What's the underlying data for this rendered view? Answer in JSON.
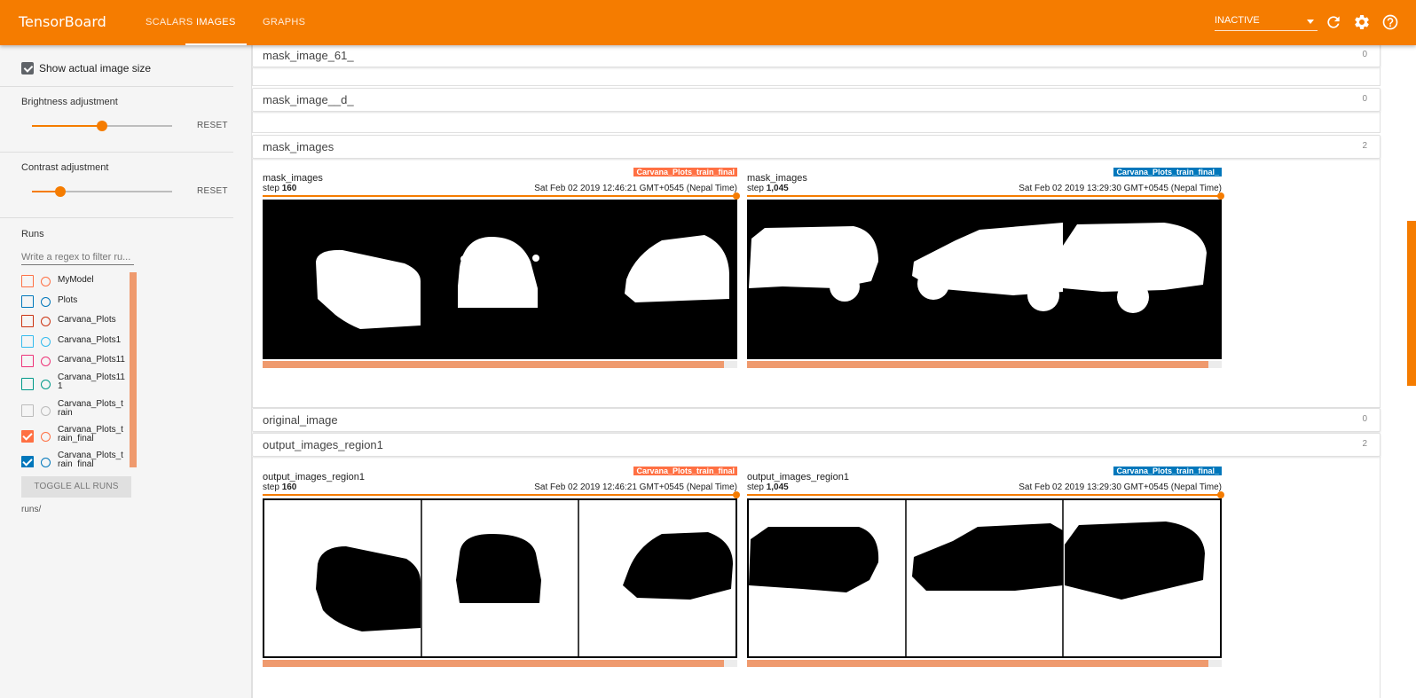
{
  "app": {
    "title": "TensorBoard"
  },
  "nav": {
    "tabs": [
      {
        "label": "SCALARS"
      },
      {
        "label": "IMAGES"
      },
      {
        "label": "GRAPHS"
      }
    ]
  },
  "header": {
    "run_select_value": "INACTIVE"
  },
  "sidebar": {
    "show_actual_size_label": "Show actual image size",
    "brightness_label": "Brightness adjustment",
    "contrast_label": "Contrast adjustment",
    "reset_label": "RESET",
    "brightness_level": 0.5,
    "contrast_level": 0.2,
    "runs_title": "Runs",
    "runs_filter_placeholder": "Write a regex to filter ru...",
    "runs": [
      {
        "name": "MyModel",
        "color": "#ff7043",
        "checked": false
      },
      {
        "name": "Plots",
        "color": "#0077bb",
        "checked": false
      },
      {
        "name": "Carvana_Plots",
        "color": "#cc3311",
        "checked": false
      },
      {
        "name": "Carvana_Plots1",
        "color": "#33bbee",
        "checked": false
      },
      {
        "name": "Carvana_Plots11",
        "color": "#ee3377",
        "checked": false
      },
      {
        "name": "Carvana_Plots111",
        "color": "#009988",
        "checked": false
      },
      {
        "name": "Carvana_Plots_train",
        "color": "#bbbbbb",
        "checked": false
      },
      {
        "name": "Carvana_Plots_train_final",
        "color": "#ff7043",
        "checked": true
      },
      {
        "name": "Carvana_Plots_train_final_",
        "color": "#0077bb",
        "checked": true
      }
    ],
    "toggle_all_label": "TOGGLE ALL RUNS",
    "logdir": "runs/"
  },
  "panes": [
    {
      "name": "mask_image_61_",
      "count": "0"
    },
    {
      "name": "mask_image__d_",
      "count": "0"
    },
    {
      "name": "mask_images",
      "count": "2"
    },
    {
      "name": "original_image",
      "count": "0"
    },
    {
      "name": "output_images_region1",
      "count": "2"
    }
  ],
  "cards": {
    "mask_left": {
      "tag": "Carvana_Plots_train_final",
      "title": "mask_images",
      "step_prefix": "step ",
      "step": "160",
      "time": "Sat Feb 02 2019 12:46:21 GMT+0545 (Nepal Time)"
    },
    "mask_right": {
      "tag": "Carvana_Plots_train_final_",
      "title": "mask_images",
      "step_prefix": "step ",
      "step": "1,045",
      "time": "Sat Feb 02 2019 13:29:30 GMT+0545 (Nepal Time)"
    },
    "out_left": {
      "tag": "Carvana_Plots_train_final",
      "title": "output_images_region1",
      "step_prefix": "step ",
      "step": "160",
      "time": "Sat Feb 02 2019 12:46:21 GMT+0545 (Nepal Time)"
    },
    "out_right": {
      "tag": "Carvana_Plots_train_final_",
      "title": "output_images_region1",
      "step_prefix": "step ",
      "step": "1,045",
      "time": "Sat Feb 02 2019 13:29:30 GMT+0545 (Nepal Time)"
    }
  },
  "colors": {
    "accent": "#f57c00",
    "run_orange": "#ff7043",
    "run_blue": "#0077bb"
  },
  "icons": {
    "refresh": "refresh-icon",
    "settings": "gear-icon",
    "help": "help-icon"
  }
}
